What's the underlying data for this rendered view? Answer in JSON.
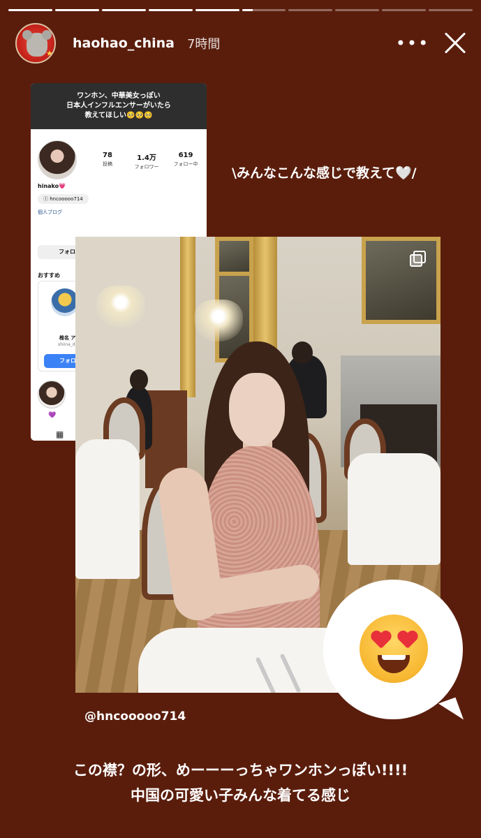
{
  "story": {
    "progress": [
      1,
      1,
      1,
      1,
      1,
      0.25,
      0,
      0,
      0,
      0
    ],
    "username": "haohao_china",
    "time_ago": "7時間",
    "more_label": "•••"
  },
  "embedded_screenshot": {
    "header_lines": [
      "ワンホン、中華美女っぽい",
      "日本人インフルエンサーがいたら",
      "教えてほしい🥺🥺🥺"
    ],
    "stats": [
      {
        "value": "78",
        "label": "投稿"
      },
      {
        "value": "1.4万",
        "label": "フォロワー"
      },
      {
        "value": "619",
        "label": "フォロー中"
      }
    ],
    "profile_name": "hinako💗",
    "threads_handle": "hncooooo714",
    "blog_link": "個人ブログ",
    "follow_label": "フォロー",
    "recommend_label": "おすすめ",
    "suggestion": {
      "name": "椎名 ア",
      "handle": "shiina_d",
      "follow_label": "フォロ"
    }
  },
  "captions": {
    "side": "\\みんなこんな感じで教えて🤍/",
    "handle": "@hncooooo714",
    "bottom_line1": "この襟？の形、めーーーっちゃワンホンっぽい!!!!",
    "bottom_line2": "中国の可愛い子みんな着てる感じ"
  },
  "icons": {
    "multi_image": "carousel-icon",
    "sticker": "heart-eyes-emoji"
  }
}
